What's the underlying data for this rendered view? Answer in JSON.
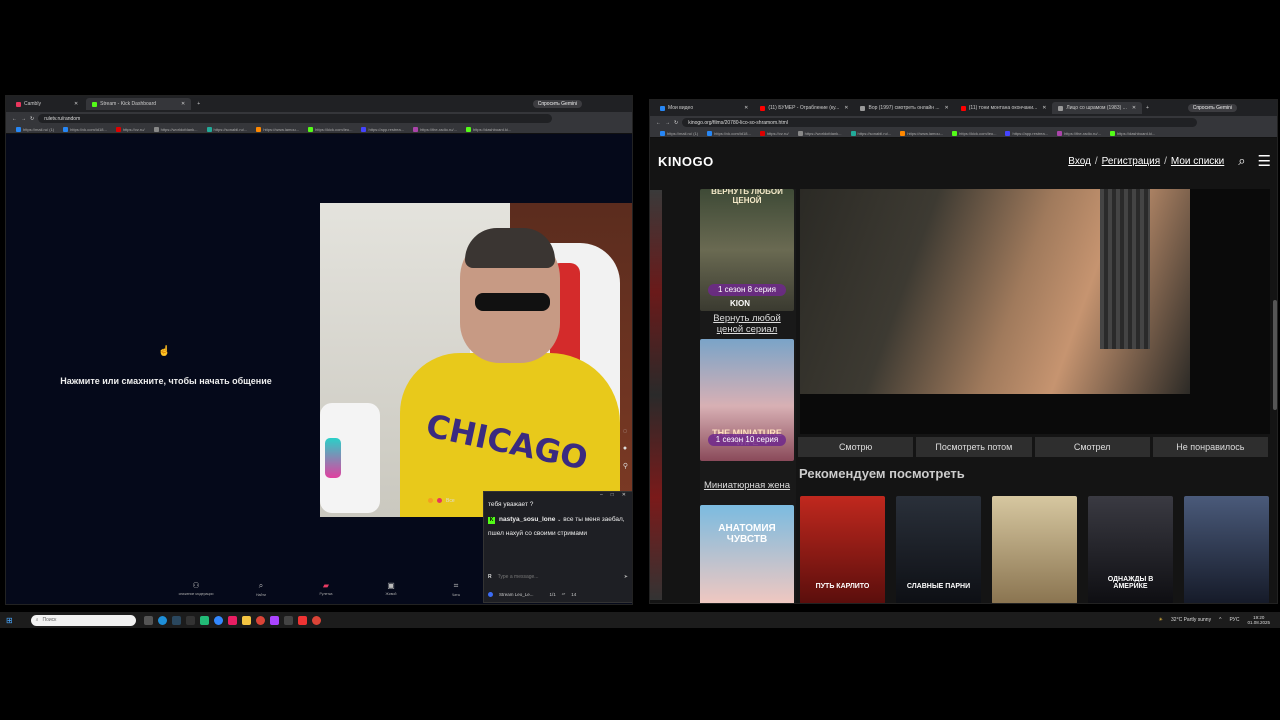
{
  "left_browser": {
    "tabs": [
      {
        "label": "Cambly",
        "color": "#e8365d"
      },
      {
        "label": "Stream - Kick Dashboard",
        "color": "#53fc18"
      }
    ],
    "gemini_label": "Спросить Gemini",
    "url": "ruletv.ru/random",
    "bookmarks": [
      "https://mail.ru/ (1)",
      "https://vk.com/id18...",
      "https://vz.ru/",
      "https://worldofdank...",
      "https://sonabil.ru/...",
      "https://www.lamou...",
      "https://kick.com/leo...",
      "https://app.restrea...",
      "https://the-radio.ru/...",
      "https://dashboard.ki..."
    ]
  },
  "roulette": {
    "prompt": "Нажмите или смахните, чтобы начать общение",
    "cam_logo": "CHICAGO",
    "reaction_label": "Все",
    "nav": [
      {
        "label": "снижение модерации",
        "icon": "people-icon"
      },
      {
        "label": "Найти",
        "icon": "search-icon"
      },
      {
        "label": "Рулетка",
        "icon": "roulette-icon"
      },
      {
        "label": "Живой",
        "icon": "chat-icon"
      },
      {
        "label": "Чаты",
        "icon": "messages-icon"
      }
    ]
  },
  "chat": {
    "prev_line": "тебя уважает ?",
    "user": "nastya_sosu_lone",
    "message": "все ты меня заебал, пшел нахуй со своими стримами",
    "input_placeholder": "Type a message...",
    "input_badge": "R",
    "footer_name": "Stream Leo_Le...",
    "footer_count1": "1/1",
    "footer_count2": "14"
  },
  "right_browser": {
    "tabs": [
      {
        "label": "Мои видео",
        "color": "#2787f5"
      },
      {
        "label": "(11) БУМЕР - Ограбление (ку...",
        "color": "#ff0000"
      },
      {
        "label": "Вор (1997) смотреть онлайн ...",
        "color": "#999999"
      },
      {
        "label": "(11) тони монтана окончани...",
        "color": "#ff0000"
      },
      {
        "label": "Лицо со шрамом (1983) ...",
        "color": "#999999"
      }
    ],
    "gemini_label": "Спросить Gemini",
    "url": "kinogo.org/films/20780-lico-so-shramom.html",
    "bookmarks": [
      "https://mail.ru/ (1)",
      "https://vk.com/id18...",
      "https://vz.ru/",
      "https://worldofdank...",
      "https://sonabil.ru/...",
      "https://www.lamou...",
      "https://kick.com/leo...",
      "https://app.restrea...",
      "https://the-radio.ru/...",
      "https://dashboard.ki..."
    ]
  },
  "kinogo": {
    "logo": "KINOGO",
    "login": "Вход",
    "register": "Регистрация",
    "lists": "Мои списки",
    "sep": "/",
    "side_posters": [
      {
        "title": "Вернуть любой ценой сериал",
        "episode": "1 сезон 8 серия",
        "brand": "KION",
        "poster_text": "ВЕРНУТЬ ЛЮБОЙ ЦЕНОЙ"
      },
      {
        "title": "Миниатюрная жена",
        "episode": "1 сезон 10 серия",
        "poster_text": "THE MINIATURE WIFE"
      }
    ],
    "bottom_poster_text": "АНАТОМИЯ ЧУВСТВ",
    "actions": [
      "Смотрю",
      "Посмотреть потом",
      "Смотрел",
      "Не понравилось"
    ],
    "recommend_title": "Рекомендуем посмотреть",
    "recommendations": [
      {
        "label": "ПУТЬ КАРЛИТО",
        "color": "#8a1a14"
      },
      {
        "label": "СЛАВНЫЕ ПАРНИ",
        "color": "#151a22"
      },
      {
        "label": "",
        "color": "#b59a6a"
      },
      {
        "label": "ОДНАЖДЫ В АМЕРИКЕ",
        "color": "#1d1d22"
      },
      {
        "label": "",
        "color": "#2a3550"
      }
    ]
  },
  "taskbar": {
    "search_placeholder": "Поиск",
    "weather": "32°C Partly sunny",
    "lang": "РУС",
    "time": "19:20",
    "date": "01.08.2025"
  }
}
